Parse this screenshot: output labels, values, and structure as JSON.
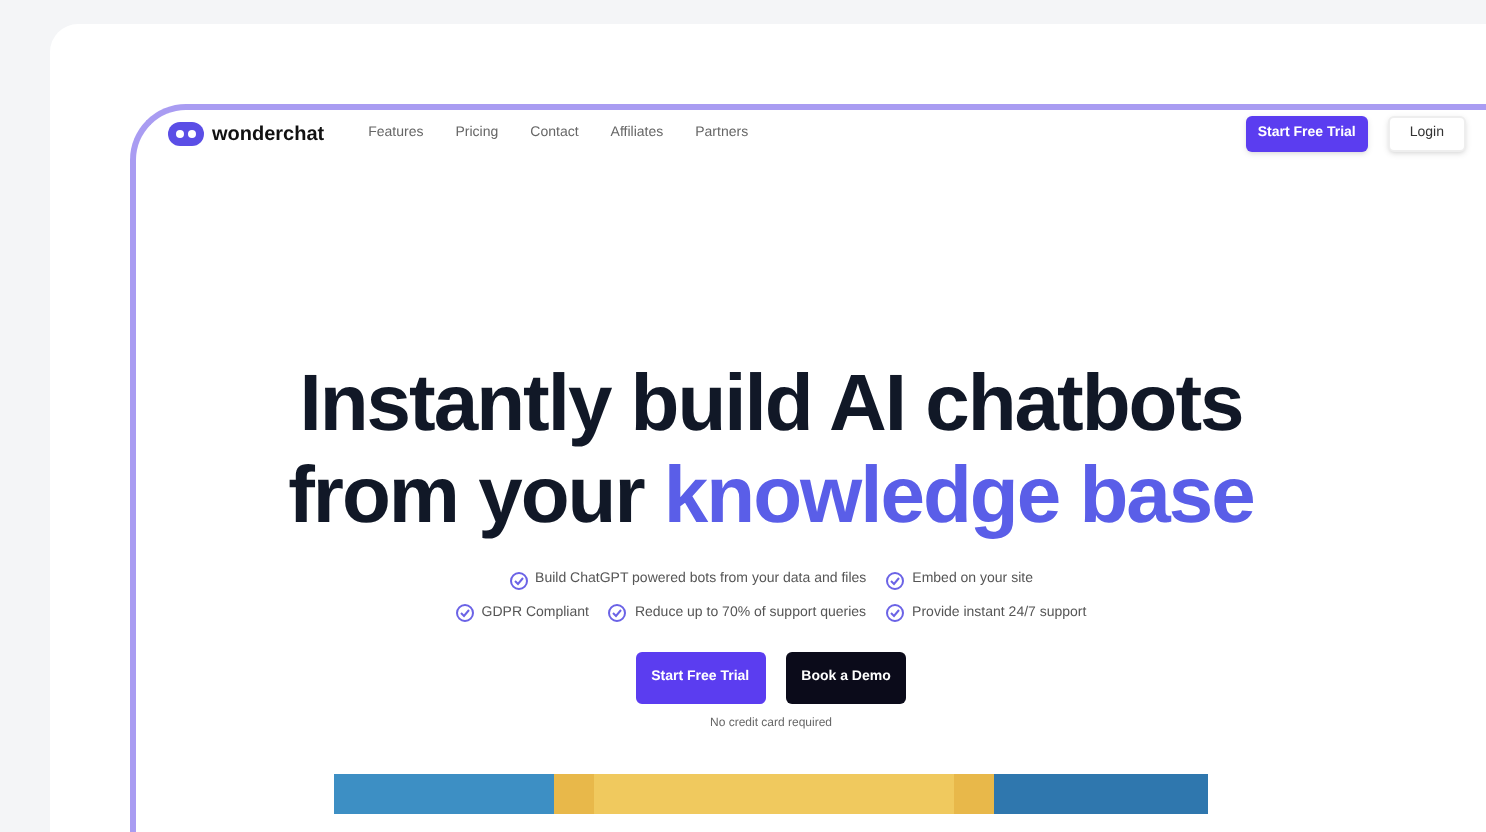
{
  "nav": {
    "logo": "wonderchat",
    "links": [
      "Features",
      "Pricing",
      "Contact",
      "Affiliates",
      "Partners"
    ],
    "cta": "Start Free Trial",
    "login": "Login"
  },
  "hero": {
    "title_line1": "Instantly build AI chatbots",
    "title_line2_plain": "from your",
    "title_line2_accent": "knowledge base",
    "features": [
      [
        "Build ChatGPT powered bots from your data and files",
        "Embed on your site"
      ],
      [
        "GDPR Compliant",
        "Reduce up to 70% of support queries",
        "Provide instant 24/7 support"
      ]
    ],
    "primary_button": "Start Free Trial",
    "secondary_button": "Book a Demo",
    "note": "No credit card required"
  }
}
